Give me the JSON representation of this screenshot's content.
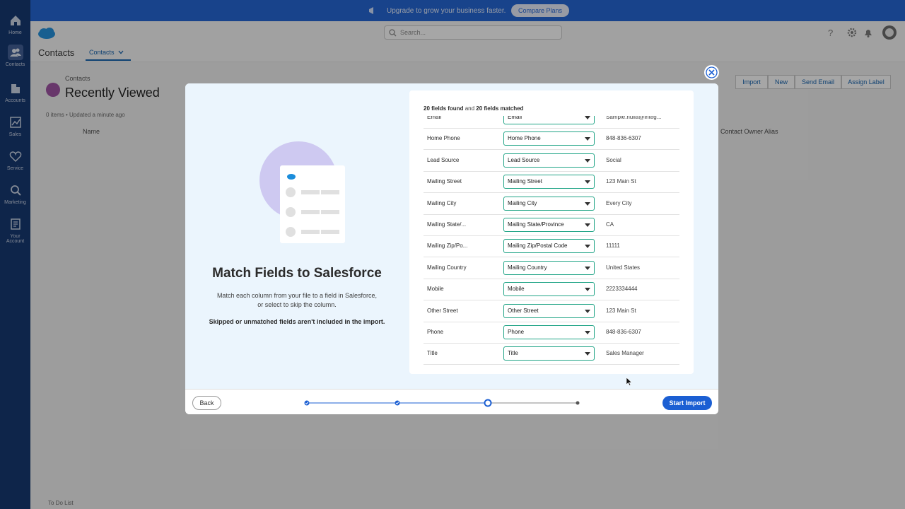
{
  "banner": {
    "text": "Upgrade to grow your business faster.",
    "cta": "Compare Plans"
  },
  "nav": [
    {
      "label": "Home",
      "icon": "home-icon"
    },
    {
      "label": "Contacts",
      "icon": "contacts-icon"
    },
    {
      "label": "Accounts",
      "icon": "accounts-icon"
    },
    {
      "label": "Sales",
      "icon": "sales-icon"
    },
    {
      "label": "Service",
      "icon": "service-icon"
    },
    {
      "label": "Marketing",
      "icon": "marketing-icon"
    },
    {
      "label": "Your",
      "label2": "Account",
      "icon": "account-icon"
    }
  ],
  "header": {
    "search_placeholder": "Search...",
    "app_title": "Contacts",
    "tab_label": "Contacts"
  },
  "list": {
    "object_label": "Contacts",
    "view_name": "Recently Viewed",
    "meta": "0 items • Updated a minute ago",
    "col_name": "Name",
    "col_owner": "Contact Owner Alias",
    "buttons": [
      "Import",
      "New",
      "Send Email",
      "Assign Label"
    ],
    "todo": "To Do List"
  },
  "modal": {
    "title": "Match Fields to Salesforce",
    "desc_line1": "Match each column from your file to a field in Salesforce,",
    "desc_line2": "or select to skip the column.",
    "note": "Skipped or unmatched fields aren't included in the import.",
    "found_count": "20 fields found",
    "found_and": "and",
    "matched_count": "20 fields matched",
    "rows": [
      {
        "column": "Email",
        "field": "Email",
        "sample": "Sample.nulla@integ..."
      },
      {
        "column": "Home Phone",
        "field": "Home Phone",
        "sample": "848-836-6307"
      },
      {
        "column": "Lead Source",
        "field": "Lead Source",
        "sample": "Social"
      },
      {
        "column": "Mailing Street",
        "field": "Mailing Street",
        "sample": "123 Main St"
      },
      {
        "column": "Mailing City",
        "field": "Mailing City",
        "sample": "Every City"
      },
      {
        "column": "Mailing State/...",
        "field": "Mailing State/Province",
        "sample": "CA"
      },
      {
        "column": "Mailing Zip/Po...",
        "field": "Mailing Zip/Postal Code",
        "sample": "11111"
      },
      {
        "column": "Mailing Country",
        "field": "Mailing Country",
        "sample": "United States"
      },
      {
        "column": "Mobile",
        "field": "Mobile",
        "sample": "2223334444"
      },
      {
        "column": "Other Street",
        "field": "Other Street",
        "sample": "123 Main St"
      },
      {
        "column": "Phone",
        "field": "Phone",
        "sample": "848-836-6307"
      },
      {
        "column": "Title",
        "field": "Title",
        "sample": "Sales Manager"
      }
    ],
    "back_label": "Back",
    "start_label": "Start Import",
    "steps": {
      "total": 4,
      "current": 3
    }
  },
  "colors": {
    "brand": "#1b5fd3",
    "nav_bg": "#0b2f6b",
    "match_border": "#20a486",
    "illustration": "#c9c4ef"
  }
}
